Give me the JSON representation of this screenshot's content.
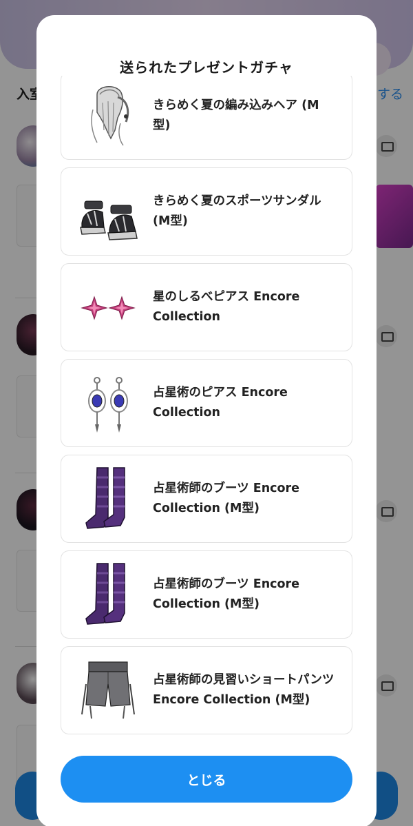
{
  "background": {
    "left_label": "入室",
    "right_link": "する"
  },
  "modal": {
    "title": "送られたプレゼントガチャ",
    "close_label": "とじる",
    "items": [
      {
        "name": "きらめく夏の編み込みヘア (M型)",
        "icon": "braided-hair-icon"
      },
      {
        "name": "きらめく夏のスポーツサンダル (M型)",
        "icon": "sandals-icon"
      },
      {
        "name": "星のしるべピアス Encore Collection",
        "icon": "star-earrings-icon"
      },
      {
        "name": "占星術のピアス Encore Collection",
        "icon": "astrology-earrings-icon"
      },
      {
        "name": "占星術師のブーツ Encore Collection (M型)",
        "icon": "boots-icon"
      },
      {
        "name": "占星術師のブーツ Encore Collection (M型)",
        "icon": "boots-icon"
      },
      {
        "name": "占星術師の見習いショートパンツ Encore Collection (M型)",
        "icon": "short-pants-icon"
      }
    ]
  },
  "colors": {
    "accent": "#1d8ff2",
    "overlay": "rgba(0,0,0,0.42)",
    "boots": "#4a2a6e",
    "earrings": "#c23d7a"
  }
}
